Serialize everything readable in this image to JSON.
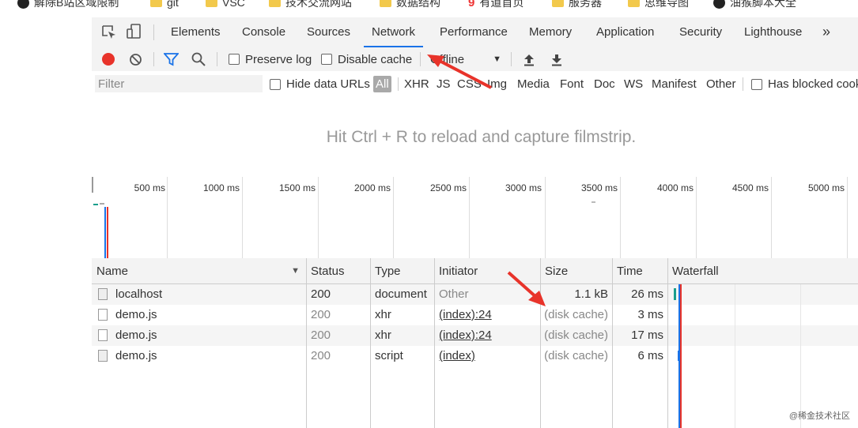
{
  "bookmarks": [
    {
      "label": "解除B站区域限制",
      "icon": "circle-logo-icon"
    },
    {
      "label": "git",
      "icon": "folder-icon"
    },
    {
      "label": "VSC",
      "icon": "folder-icon"
    },
    {
      "label": "技术交流网站",
      "icon": "folder-icon"
    },
    {
      "label": "数据结构",
      "icon": "folder-icon"
    },
    {
      "label": "有道首页",
      "icon": "youdao-icon"
    },
    {
      "label": "服务器",
      "icon": "folder-icon"
    },
    {
      "label": "思维导图",
      "icon": "folder-icon"
    },
    {
      "label": "油猴脚本大全",
      "icon": "circle-logo-icon"
    }
  ],
  "devtools": {
    "tabs": [
      "Elements",
      "Console",
      "Sources",
      "Network",
      "Performance",
      "Memory",
      "Application",
      "Security",
      "Lighthouse"
    ],
    "active_tab": "Network",
    "more_tabs": "»",
    "toolbar": {
      "preserve_log": "Preserve log",
      "disable_cache": "Disable cache",
      "throttling": "Offline"
    },
    "filter": {
      "placeholder": "Filter",
      "hide_data_urls": "Hide data URLs",
      "types": [
        "All",
        "XHR",
        "JS",
        "CSS",
        "Img",
        "Media",
        "Font",
        "Doc",
        "WS",
        "Manifest",
        "Other"
      ],
      "has_blocked": "Has blocked cookies"
    },
    "filmstrip_message": "Hit Ctrl + R to reload and capture filmstrip.",
    "timeline_ticks": [
      "500 ms",
      "1000 ms",
      "1500 ms",
      "2000 ms",
      "2500 ms",
      "3000 ms",
      "3500 ms",
      "4000 ms",
      "4500 ms",
      "5000 ms"
    ],
    "columns": [
      "Name",
      "Status",
      "Type",
      "Initiator",
      "Size",
      "Time",
      "Waterfall"
    ],
    "requests": [
      {
        "name": "localhost",
        "status": "200",
        "type": "document",
        "initiator": "Other",
        "size": "1.1 kB",
        "time": "26 ms"
      },
      {
        "name": "demo.js",
        "status": "200",
        "type": "xhr",
        "initiator": "(index):24",
        "size": "(disk cache)",
        "time": "3 ms"
      },
      {
        "name": "demo.js",
        "status": "200",
        "type": "xhr",
        "initiator": "(index):24",
        "size": "(disk cache)",
        "time": "17 ms"
      },
      {
        "name": "demo.js",
        "status": "200",
        "type": "script",
        "initiator": "(index)",
        "size": "(disk cache)",
        "time": "6 ms"
      }
    ]
  },
  "watermark": "@稀金技术社区",
  "colors": {
    "accent": "#1a73e8",
    "record": "#e8332a",
    "annotation_arrow": "#e8332a"
  }
}
